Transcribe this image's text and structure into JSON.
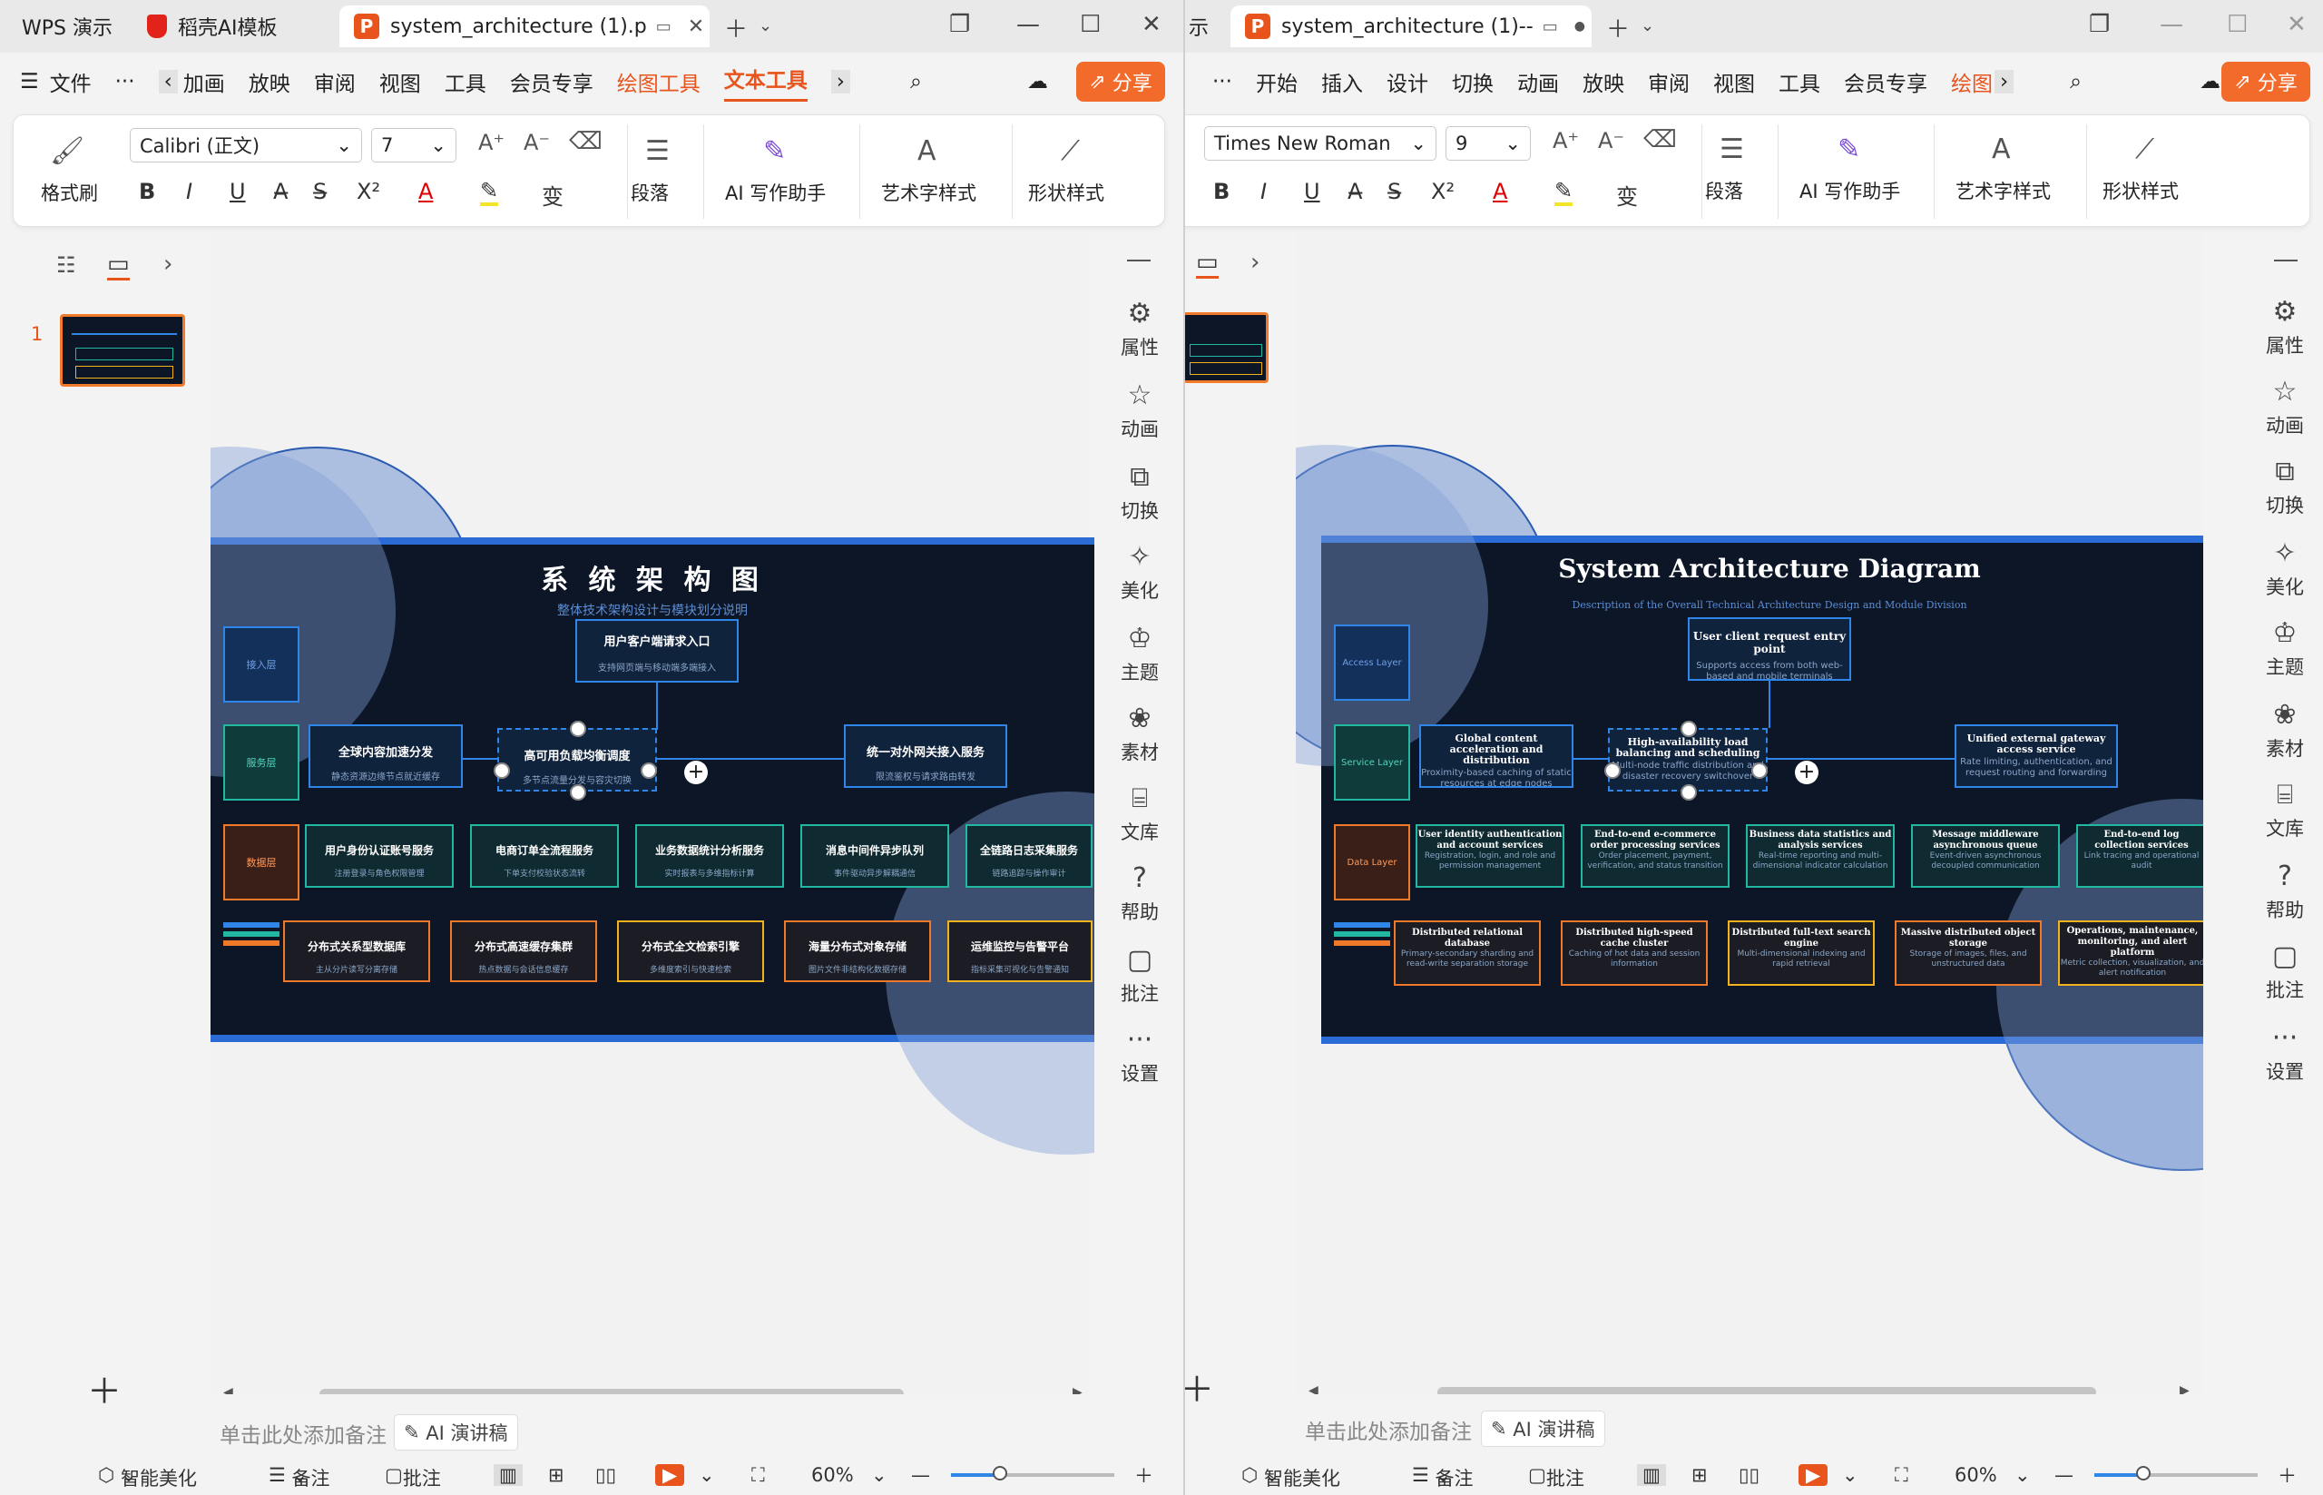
{
  "left_window": {
    "tabs": [
      {
        "label": "WPS 演示"
      },
      {
        "label": "稻壳AI模板"
      },
      {
        "label": "system_architecture (1).p"
      }
    ],
    "menu": {
      "file": "文件",
      "items": [
        "加画",
        "放映",
        "审阅",
        "视图",
        "工具",
        "会员专享"
      ],
      "drawing_tools": "绘图工具",
      "text_tools": "文本工具",
      "share": "分享"
    },
    "ribbon": {
      "format_painter": "格式刷",
      "font": "Calibri (正文)",
      "size": "7",
      "paragraph": "段落",
      "ai_writer": "AI 写作助手",
      "art_text": "艺术字样式",
      "shape_style": "形状样式"
    },
    "slide_number": "1",
    "slide": {
      "title": "系 统 架 构 图",
      "subtitle": "整体技术架构设计与模块划分说明",
      "layers": [
        "接入层",
        "服务层",
        "数据层"
      ],
      "entry": {
        "title": "用户客户端请求入口",
        "desc": "支持网页端与移动端多端接入"
      },
      "services_top": [
        {
          "title": "全球内容加速分发",
          "desc": "静态资源边缘节点就近缓存"
        },
        {
          "title": "高可用负载均衡调度",
          "desc": "多节点流量分发与容灾切换"
        },
        {
          "title": "统一对外网关接入服务",
          "desc": "限流鉴权与请求路由转发"
        }
      ],
      "services_mid": [
        {
          "title": "用户身份认证账号服务",
          "desc": "注册登录与角色权限管理"
        },
        {
          "title": "电商订单全流程服务",
          "desc": "下单支付校验状态流转"
        },
        {
          "title": "业务数据统计分析服务",
          "desc": "实时报表与多维指标计算"
        },
        {
          "title": "消息中间件异步队列",
          "desc": "事件驱动异步解耦通信"
        },
        {
          "title": "全链路日志采集服务",
          "desc": "链路追踪与操作审计"
        }
      ],
      "data_nodes": [
        {
          "title": "分布式关系型数据库",
          "desc": "主从分片读写分离存储"
        },
        {
          "title": "分布式高速缓存集群",
          "desc": "热点数据与会话信息缓存"
        },
        {
          "title": "分布式全文检索引擎",
          "desc": "多维度索引与快速检索"
        },
        {
          "title": "海量分布式对象存储",
          "desc": "图片文件非结构化数据存储"
        },
        {
          "title": "运维监控与告警平台",
          "desc": "指标采集可视化与告警通知"
        }
      ]
    },
    "notes_placeholder": "单击此处添加备注",
    "ai_speech": "AI 演讲稿",
    "status": {
      "beautify": "智能美化",
      "notes": "备注",
      "comments": "批注",
      "zoom": "60%"
    },
    "right_tools": [
      "属性",
      "动画",
      "切换",
      "美化",
      "主题",
      "素材",
      "文库",
      "帮助",
      "批注",
      "设置"
    ]
  },
  "right_window": {
    "tabs": [
      {
        "label": "示"
      },
      {
        "label": "system_architecture (1)--"
      }
    ],
    "menu": {
      "items": [
        "开始",
        "插入",
        "设计",
        "切换",
        "动画",
        "放映",
        "审阅",
        "视图",
        "工具",
        "会员专享"
      ],
      "drawing_tools": "绘图",
      "share": "分享"
    },
    "ribbon": {
      "font": "Times New Roman",
      "size": "9",
      "paragraph": "段落",
      "ai_writer": "AI 写作助手",
      "art_text": "艺术字样式",
      "shape_style": "形状样式"
    },
    "slide": {
      "title": "System Architecture Diagram",
      "subtitle": "Description of the Overall Technical Architecture Design and Module Division",
      "layers": [
        "Access Layer",
        "Service Layer",
        "Data Layer"
      ],
      "entry": {
        "title": "User client request entry point",
        "desc": "Supports access from both web-based and mobile terminals"
      },
      "services_top": [
        {
          "title": "Global content acceleration and distribution",
          "desc": "Proximity-based caching of static resources at edge nodes"
        },
        {
          "title": "High-availability load balancing and scheduling",
          "desc": "Multi-node traffic distribution and disaster recovery switchover"
        },
        {
          "title": "Unified external gateway access service",
          "desc": "Rate limiting, authentication, and request routing and forwarding"
        }
      ],
      "services_mid": [
        {
          "title": "User identity authentication and account services",
          "desc": "Registration, login, and role and permission management"
        },
        {
          "title": "End-to-end e-commerce order processing services",
          "desc": "Order placement, payment, verification, and status transition"
        },
        {
          "title": "Business data statistics and analysis services",
          "desc": "Real-time reporting and multi-dimensional indicator calculation"
        },
        {
          "title": "Message middleware asynchronous queue",
          "desc": "Event-driven asynchronous decoupled communication"
        },
        {
          "title": "End-to-end log collection services",
          "desc": "Link tracing and operational audit"
        }
      ],
      "data_nodes": [
        {
          "title": "Distributed relational database",
          "desc": "Primary-secondary sharding and read-write separation storage"
        },
        {
          "title": "Distributed high-speed cache cluster",
          "desc": "Caching of hot data and session information"
        },
        {
          "title": "Distributed full-text search engine",
          "desc": "Multi-dimensional indexing and rapid retrieval"
        },
        {
          "title": "Massive distributed object storage",
          "desc": "Storage of images, files, and unstructured data"
        },
        {
          "title": "Operations, maintenance, monitoring, and alert platform",
          "desc": "Metric collection, visualization, and alert notification"
        }
      ]
    },
    "notes_placeholder": "单击此处添加备注",
    "ai_speech": "AI 演讲稿",
    "status": {
      "beautify": "智能美化",
      "notes": "备注",
      "comments": "批注",
      "zoom": "60%"
    },
    "right_tools": [
      "属性",
      "动画",
      "切换",
      "美化",
      "主题",
      "素材",
      "文库",
      "帮助",
      "批注",
      "设置"
    ]
  },
  "colors": {
    "accent": "#e8541c",
    "blue": "#2f86e8",
    "teal": "#22b7a0",
    "orange": "#f07a2a",
    "yellow": "#f2b21c",
    "slide_bg": "#0c1626"
  }
}
